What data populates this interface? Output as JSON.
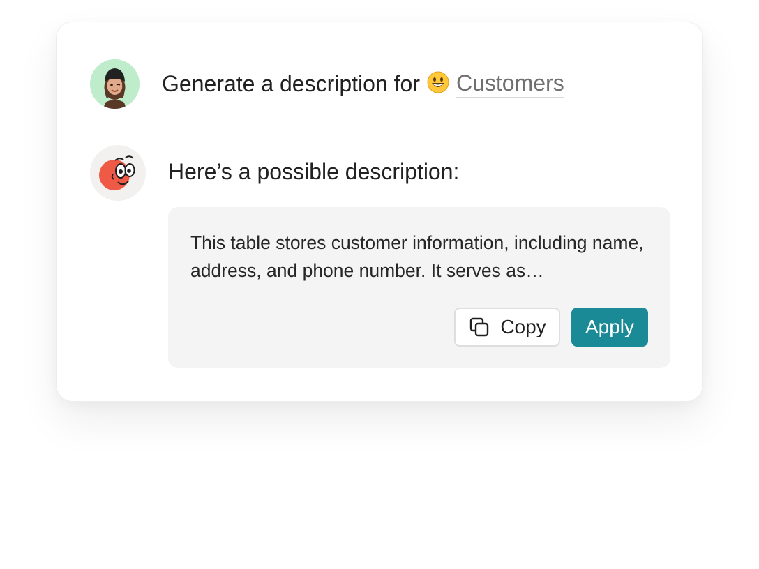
{
  "prompt": {
    "text": "Generate a description for",
    "emoji": "grinning-face-emoji",
    "table_name": "Customers"
  },
  "response": {
    "intro": "Here’s a possible description:",
    "suggestion": "This table stores customer information, including name, address, and phone number. It serves as…",
    "copy_label": "Copy",
    "apply_label": "Apply"
  },
  "colors": {
    "user_avatar_bg": "#bfeccb",
    "bot_avatar_bg": "#f2f1ef",
    "apply_button": "#1a8a96",
    "link_text": "#707070",
    "suggestion_bg": "#f4f4f4"
  },
  "icons": {
    "user_avatar": "memoji-user-avatar",
    "bot_avatar": "bot-mascot-avatar",
    "copy": "copy-icon"
  }
}
